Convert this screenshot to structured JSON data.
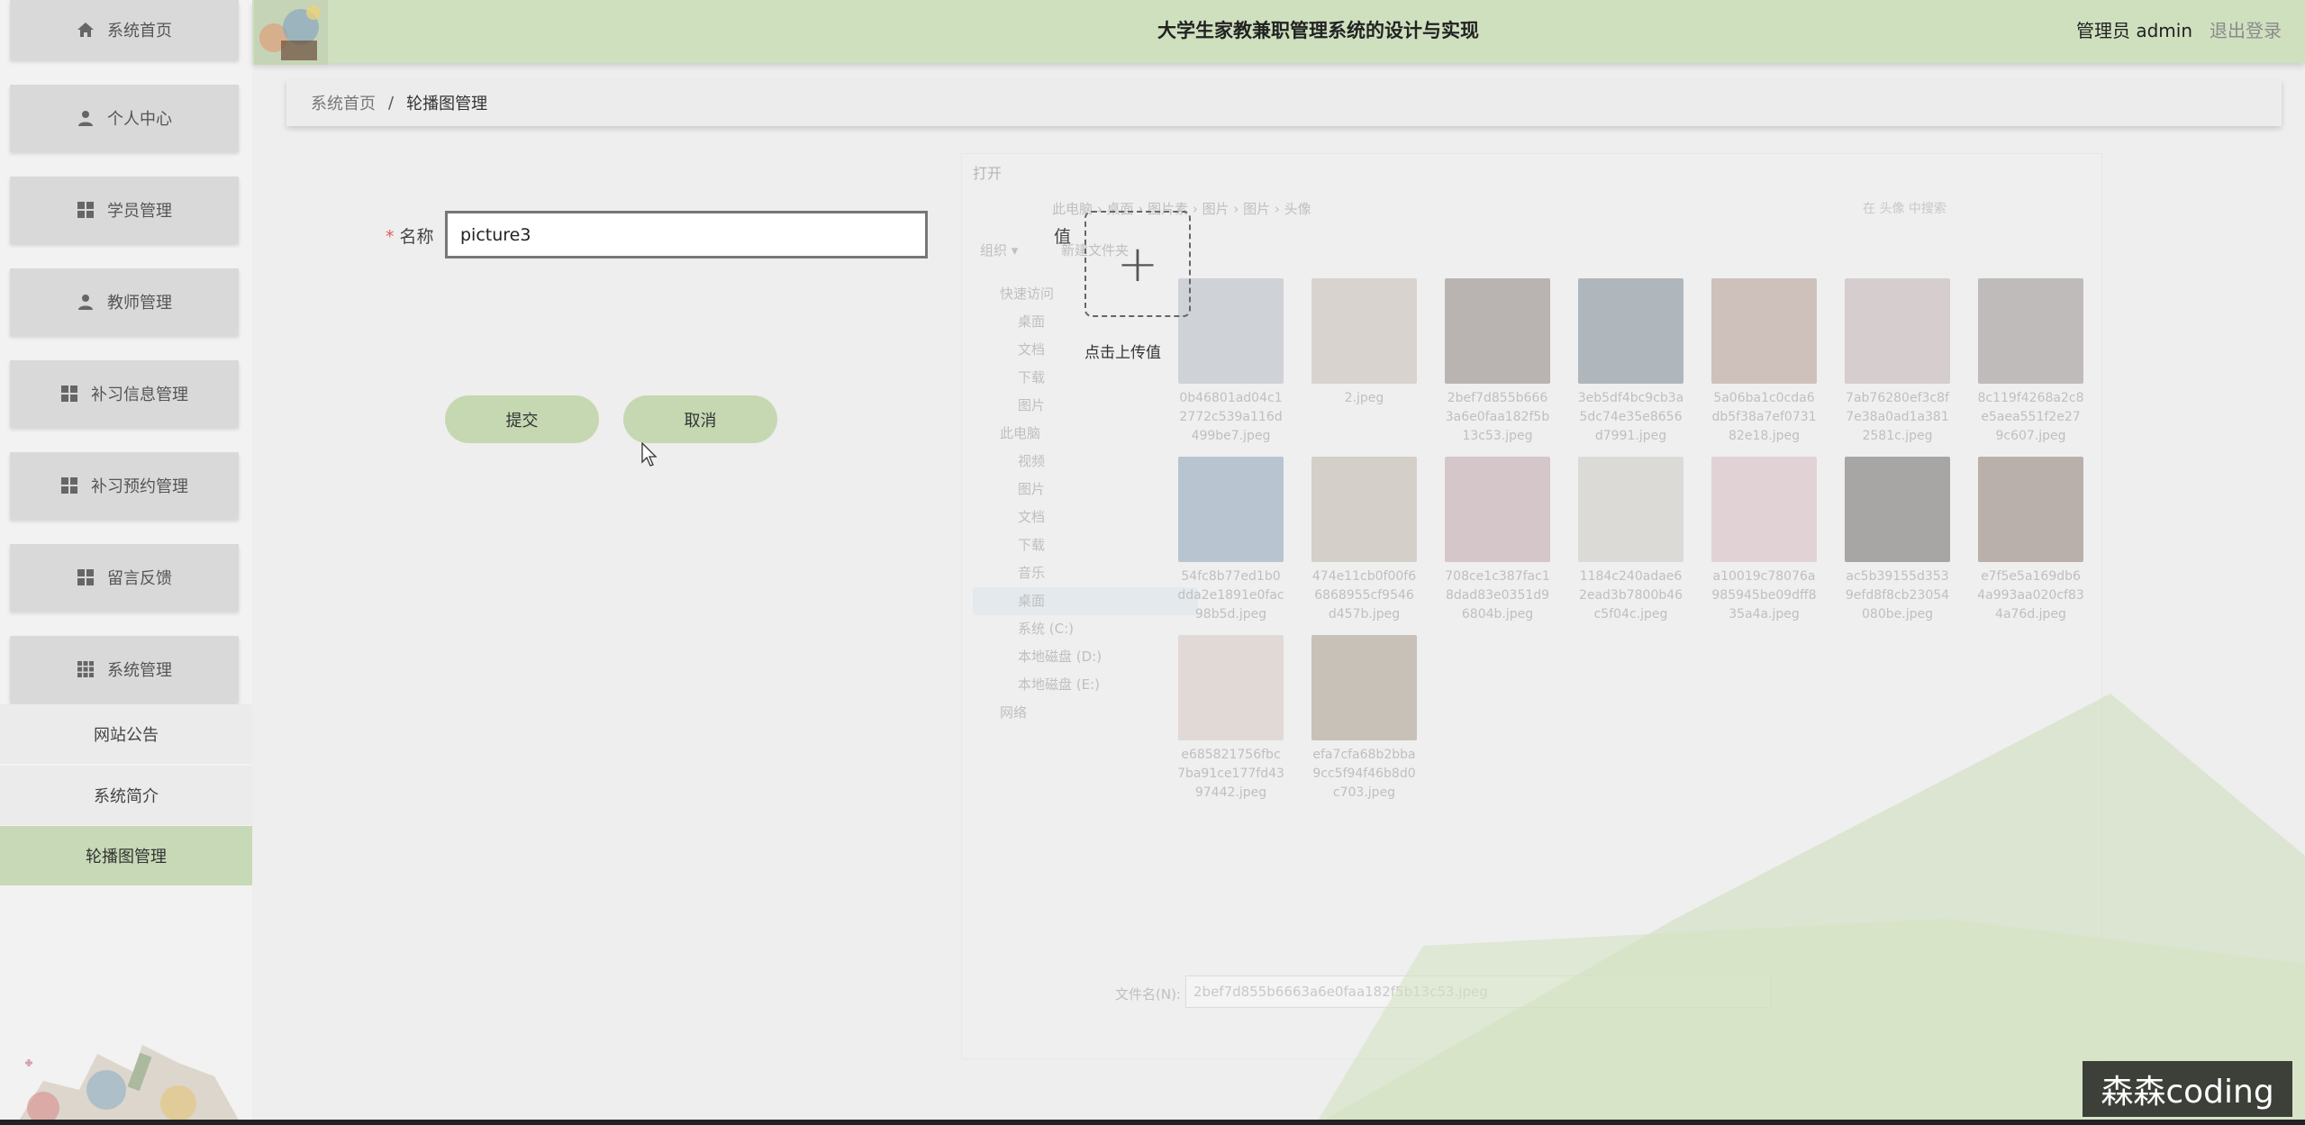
{
  "header": {
    "title": "大学生家教兼职管理系统的设计与实现",
    "admin_label": "管理员 admin",
    "logout_label": "退出登录"
  },
  "sidebar": {
    "items": [
      {
        "label": "系统首页",
        "icon": "home-icon"
      },
      {
        "label": "个人中心",
        "icon": "user-icon"
      },
      {
        "label": "学员管理",
        "icon": "grid-icon"
      },
      {
        "label": "教师管理",
        "icon": "user-icon"
      },
      {
        "label": "补习信息管理",
        "icon": "grid-icon"
      },
      {
        "label": "补习预约管理",
        "icon": "grid-icon"
      },
      {
        "label": "留言反馈",
        "icon": "grid-icon"
      },
      {
        "label": "系统管理",
        "icon": "apps-icon"
      }
    ],
    "sub_items": [
      {
        "label": "网站公告"
      },
      {
        "label": "系统简介"
      },
      {
        "label": "轮播图管理",
        "active": true
      }
    ]
  },
  "breadcrumb": {
    "home": "系统首页",
    "separator": "/",
    "current": "轮播图管理"
  },
  "form": {
    "name_label": "名称",
    "name_value": "picture3",
    "value_label": "值",
    "upload_label": "点击上传值",
    "submit_label": "提交",
    "cancel_label": "取消"
  },
  "file_dialog": {
    "title": "打开",
    "path": "此电脑 › 桌面 › 图片素 › 图片 › 图片 › 头像",
    "search_placeholder": "在 头像 中搜索",
    "organize": "组织 ▾",
    "new_folder": "新建文件夹",
    "nav": [
      {
        "label": "快速访问",
        "head": true
      },
      {
        "label": "桌面"
      },
      {
        "label": "文档"
      },
      {
        "label": "下载"
      },
      {
        "label": "图片"
      },
      {
        "label": "此电脑",
        "head": true
      },
      {
        "label": "视频"
      },
      {
        "label": "图片"
      },
      {
        "label": "文档"
      },
      {
        "label": "下载"
      },
      {
        "label": "音乐"
      },
      {
        "label": "桌面",
        "selected": true
      },
      {
        "label": "系统 (C:)"
      },
      {
        "label": "本地磁盘 (D:)"
      },
      {
        "label": "本地磁盘 (E:)"
      },
      {
        "label": "网络",
        "head": true
      }
    ],
    "files": [
      {
        "name": "0b46801ad04c12772c539a116d499be7.jpeg",
        "color": "#b7bcc4"
      },
      {
        "name": "2.jpeg",
        "color": "#c9bdb6"
      },
      {
        "name": "2bef7d855b6663a6e0faa182f5b13c53.jpeg",
        "color": "#8e8580"
      },
      {
        "name": "3eb5df4bc9cb3a5dc74e35e8656d7991.jpeg",
        "color": "#7d8a95"
      },
      {
        "name": "5a06ba1c0cda6db5f38a7ef073182e18.jpeg",
        "color": "#b49e92"
      },
      {
        "name": "7ab76280ef3c8f7e38a0ad1a3812581c.jpeg",
        "color": "#c2b3b5"
      },
      {
        "name": "8c119f4268a2c8e5aea551f2e279c607.jpeg",
        "color": "#9a9390"
      },
      {
        "name": "54fc8b77ed1b0dda2e1891e0fac98b5d.jpeg",
        "color": "#8ca4ba"
      },
      {
        "name": "474e11cb0f00f66868955cf9546d457b.jpeg",
        "color": "#bfb8ab"
      },
      {
        "name": "708ce1c387fac18dad83e0351d96804b.jpeg",
        "color": "#c1a6ac"
      },
      {
        "name": "1184c240adae62ead3b7800b46c5f04c.jpeg",
        "color": "#cfcac6"
      },
      {
        "name": "a10019c78076a985945be09dff835a4a.jpeg",
        "color": "#d6bcc2"
      },
      {
        "name": "ac5b39155d3539efd8f8cb23054080be.jpeg",
        "color": "#6f6b6b"
      },
      {
        "name": "e7f5e5a169db64a993aa020cf834a76d.jpeg",
        "color": "#8f7f75"
      },
      {
        "name": "e685821756fbc7ba91ce177fd4397442.jpeg",
        "color": "#d8c8c3"
      },
      {
        "name": "efa7cfa68b2bba9cc5f94f46b8d0c703.jpeg",
        "color": "#a89d8c"
      }
    ],
    "filename_label": "文件名(N):",
    "filename_value": "2bef7d855b6663a6e0faa182f5b13c53.jpeg"
  },
  "watermark": "森森coding",
  "colors": {
    "accent": "#c5d8b2",
    "header": "#cfe0bf",
    "active_sub": "#c7d9b6"
  }
}
